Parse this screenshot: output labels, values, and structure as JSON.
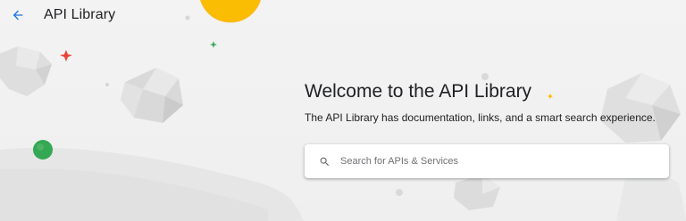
{
  "header": {
    "back_icon": "arrow-back-icon",
    "title": "API Library"
  },
  "welcome": {
    "title": "Welcome to the API Library",
    "description": "The API Library has documentation, links, and a smart search experience."
  },
  "search": {
    "icon": "search-icon",
    "placeholder": "Search for APIs & Services",
    "value": ""
  },
  "colors": {
    "accent_blue": "#1a73e8",
    "decor_yellow": "#fbbc04",
    "decor_green": "#34a853",
    "decor_red": "#ea4335"
  }
}
